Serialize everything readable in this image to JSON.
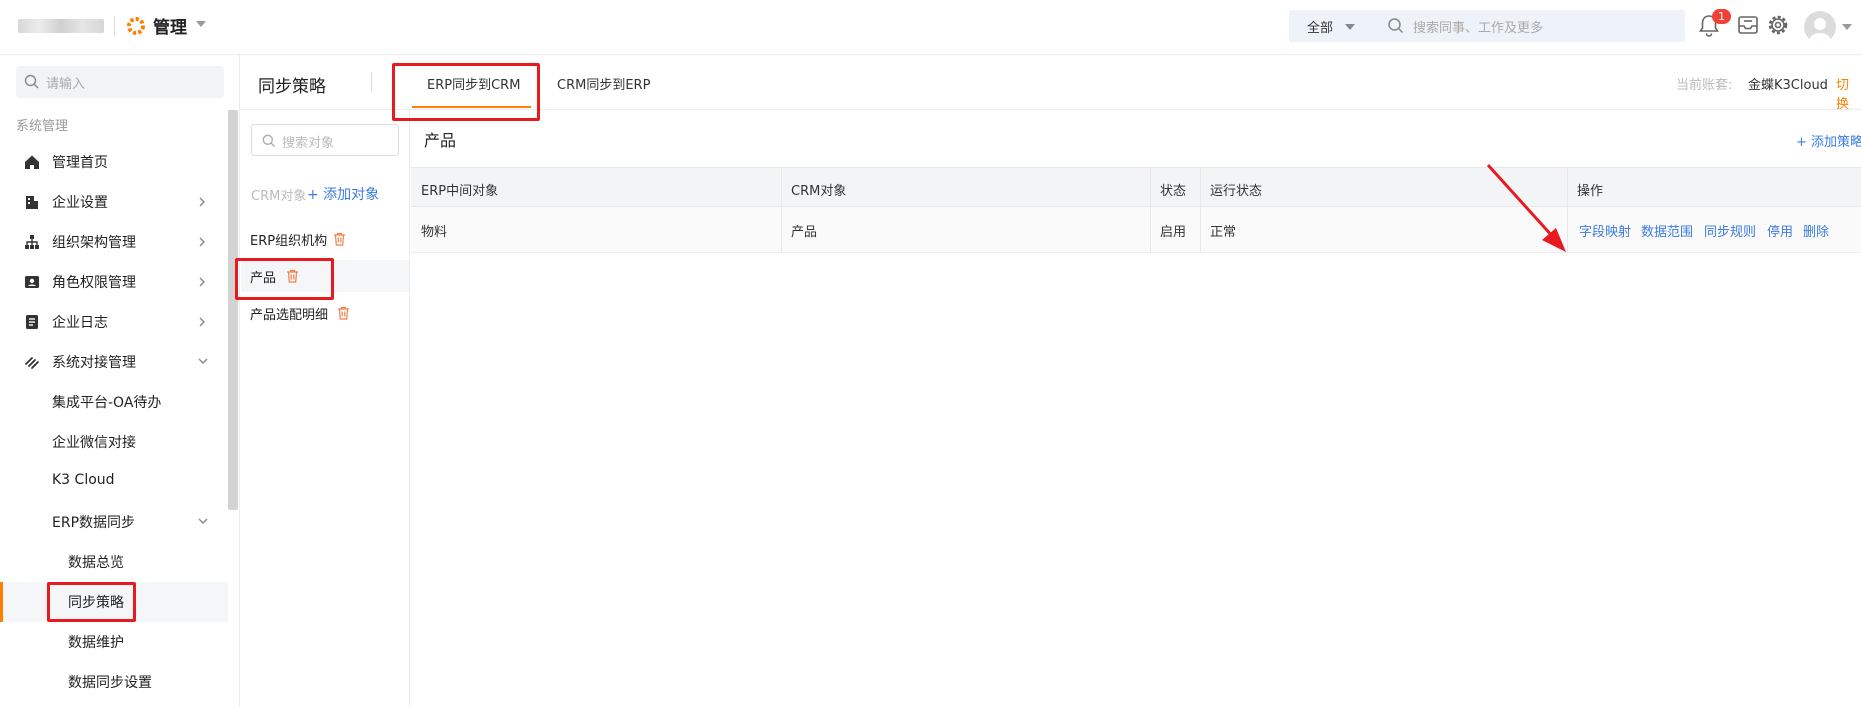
{
  "topbar": {
    "brand_title": "管理",
    "search_scope": "全部",
    "search_placeholder": "搜索同事、工作及更多",
    "notification_count": "1"
  },
  "sidebar": {
    "search_placeholder": "请输入",
    "section_label": "系统管理",
    "items": [
      {
        "label": "管理首页",
        "icon": "home-icon"
      },
      {
        "label": "企业设置",
        "icon": "building-icon"
      },
      {
        "label": "组织架构管理",
        "icon": "org-chart-icon"
      },
      {
        "label": "角色权限管理",
        "icon": "id-card-icon"
      },
      {
        "label": "企业日志",
        "icon": "document-icon"
      },
      {
        "label": "系统对接管理",
        "icon": "link-icon"
      }
    ],
    "sub_items": [
      "集成平台-OA待办",
      "企业微信对接",
      "K3 Cloud",
      "ERP数据同步"
    ],
    "sub2_items": [
      "数据总览",
      "同步策略",
      "数据维护",
      "数据同步设置"
    ]
  },
  "header": {
    "page_title": "同步策略",
    "tabs": [
      "ERP同步到CRM",
      "CRM同步到ERP"
    ],
    "account_label": "当前账套:",
    "account_name": "金蝶K3Cloud",
    "account_switch": "切换"
  },
  "objects": {
    "search_placeholder": "搜索对象",
    "head_label": "CRM对象",
    "add_label": "+ 添加对象",
    "items": [
      "ERP组织机构",
      "产品",
      "产品选配明细"
    ]
  },
  "content": {
    "title": "产品",
    "add_policy": "+ 添加策略",
    "table": {
      "headers": [
        "ERP中间对象",
        "CRM对象",
        "状态",
        "运行状态",
        "操作"
      ],
      "rows": [
        {
          "erp": "物料",
          "crm": "产品",
          "status": "启用",
          "run_status": "正常",
          "actions": [
            "字段映射",
            "数据范围",
            "同步规则",
            "停用",
            "删除"
          ]
        }
      ]
    }
  },
  "colors": {
    "accent": "#ff8000",
    "link": "#3c7ce0",
    "highlight": "#e8191f"
  }
}
